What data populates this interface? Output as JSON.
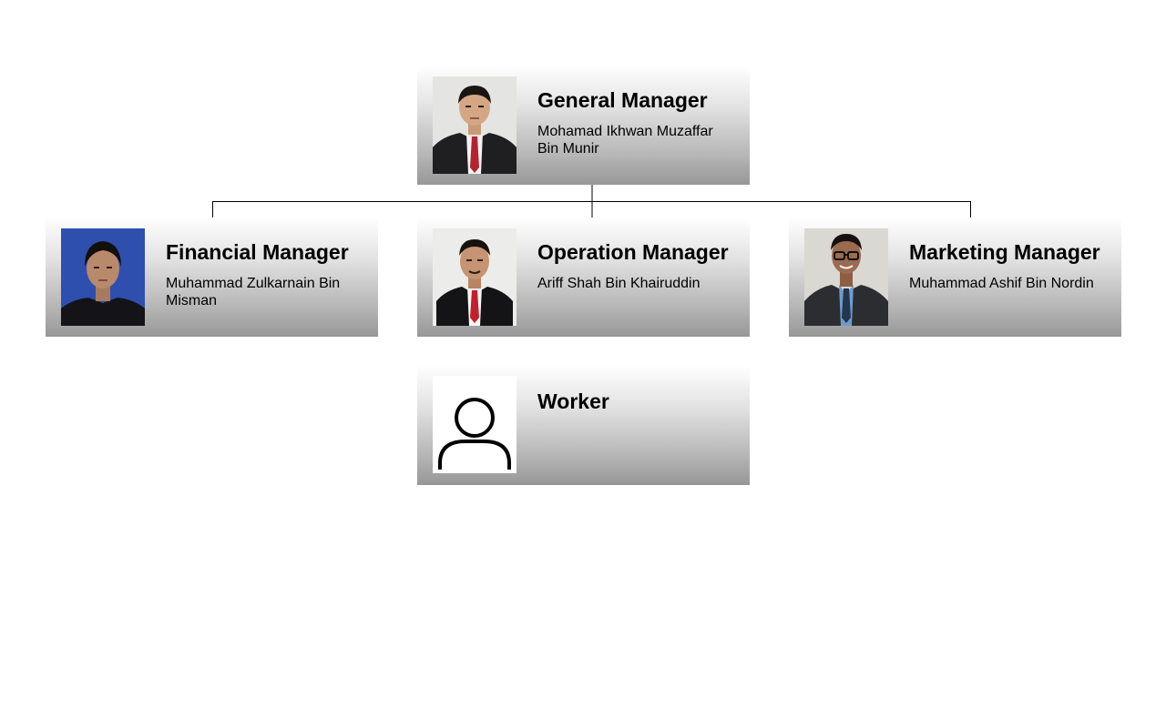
{
  "org_chart": {
    "general_manager": {
      "title": "General Manager",
      "name": "Mohamad Ikhwan Muzaffar Bin Munir",
      "photo": "person-photo-red-tie"
    },
    "financial_manager": {
      "title": "Financial Manager",
      "name": "Muhammad Zulkarnain Bin Misman",
      "photo": "person-photo-blue-background"
    },
    "operation_manager": {
      "title": "Operation Manager",
      "name": "Ariff Shah Bin Khairuddin",
      "photo": "person-photo-red-tie"
    },
    "marketing_manager": {
      "title": "Marketing Manager",
      "name": "Muhammad Ashif Bin Nordin",
      "photo": "person-photo-glasses-blue-tie"
    },
    "worker": {
      "title": "Worker",
      "photo": "user-placeholder-icon"
    }
  },
  "colors": {
    "card_gradient_top": "#ffffff",
    "card_gradient_bottom": "#979797",
    "connector": "#000000",
    "text": "#000000"
  }
}
